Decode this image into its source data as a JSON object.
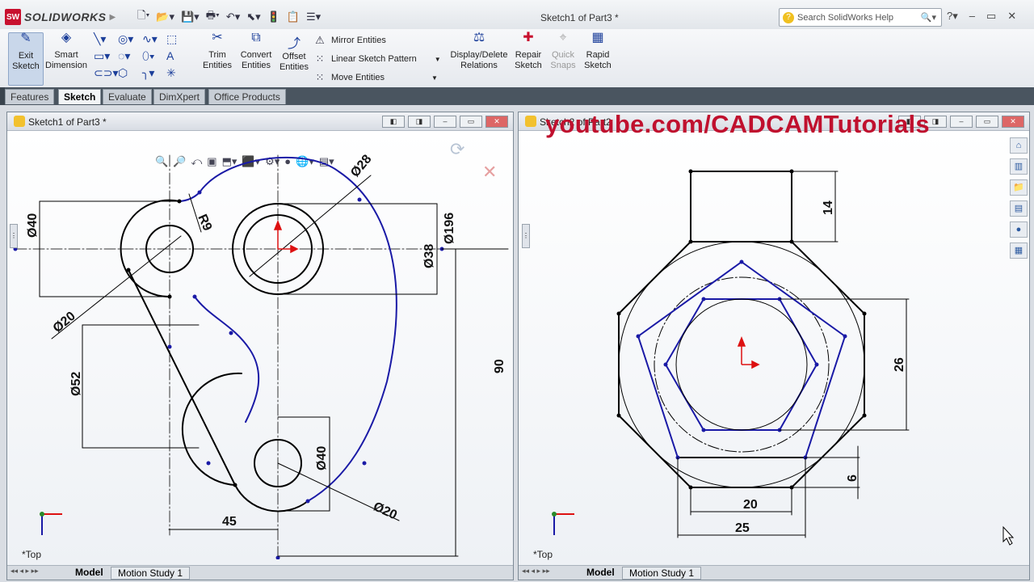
{
  "app": {
    "brand": "SOLIDWORKS",
    "brand_badge": "SW",
    "doc_title": "Sketch1 of Part3 *",
    "search_placeholder": "Search SolidWorks Help"
  },
  "command_manager": {
    "exit_sketch": "Exit Sketch",
    "smart_dimension": "Smart Dimension",
    "trim_entities": "Trim Entities",
    "convert_entities": "Convert Entities",
    "offset_entities": "Offset Entities",
    "mirror_entities": "Mirror Entities",
    "linear_sketch_pattern": "Linear Sketch Pattern",
    "move_entities": "Move Entities",
    "display_delete_relations": "Display/Delete Relations",
    "repair_sketch": "Repair Sketch",
    "quick_snaps": "Quick Snaps",
    "rapid_sketch": "Rapid Sketch"
  },
  "tabs": [
    "Features",
    "Sketch",
    "Evaluate",
    "DimXpert",
    "Office Products"
  ],
  "viewport_left": {
    "title": "Sketch1 of Part3 *",
    "view": "*Top",
    "bottom_tabs": [
      "Model",
      "Motion Study 1"
    ],
    "dims": {
      "d40": "Ø40",
      "r9": "R9",
      "d28": "Ø28",
      "d196": "Ø196",
      "d38": "Ø38",
      "d20a": "Ø20",
      "d52": "Ø52",
      "d90": "90",
      "d40b": "Ø40",
      "d45": "45",
      "d20b": "Ø20"
    }
  },
  "viewport_right": {
    "title": "Sketch2 of Part2",
    "view": "*Top",
    "bottom_tabs": [
      "Model",
      "Motion Study 1"
    ],
    "dims": {
      "d14": "14",
      "d26": "26",
      "d6": "6",
      "d20": "20",
      "d25": "25"
    }
  },
  "watermark": "youtube.com/CADCAMTutorials"
}
